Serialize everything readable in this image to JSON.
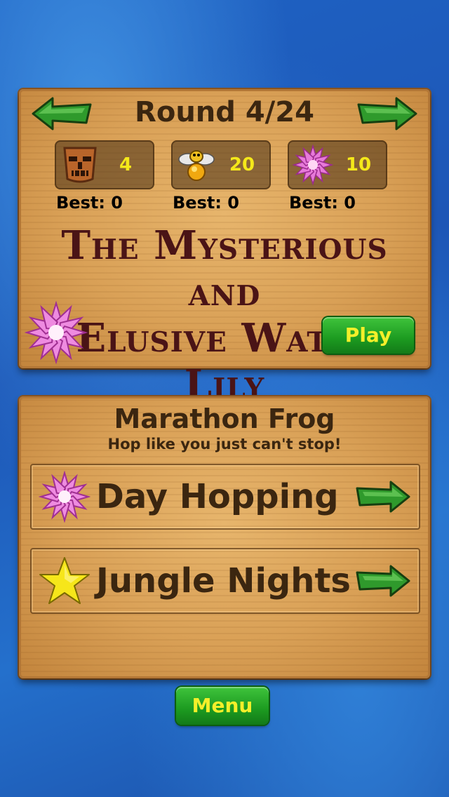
{
  "round": {
    "title": "Round 4/24",
    "stats": [
      {
        "icon": "tiki-mask-icon",
        "value": "4",
        "best": "Best: 0"
      },
      {
        "icon": "firefly-icon",
        "value": "20",
        "best": "Best: 0"
      },
      {
        "icon": "water-lily-icon",
        "value": "10",
        "best": "Best: 0"
      }
    ],
    "level_name_line1": "The Mysterious and",
    "level_name_line2": "Elusive Water Lily",
    "play_label": "Play"
  },
  "marathon": {
    "title": "Marathon Frog",
    "subtitle": "Hop like you just can't stop!",
    "modes": [
      {
        "label": "Day Hopping",
        "icon": "water-lily-icon"
      },
      {
        "label": "Jungle Nights",
        "icon": "star-icon"
      }
    ]
  },
  "menu_label": "Menu",
  "colors": {
    "background": "#1f63c4",
    "wood": "#d9a056",
    "button_green": "#1c9a20",
    "button_text": "#f4ef2a",
    "stat_text": "#f4e81a",
    "title_text": "#3b2610",
    "level_text": "#4a1416"
  }
}
